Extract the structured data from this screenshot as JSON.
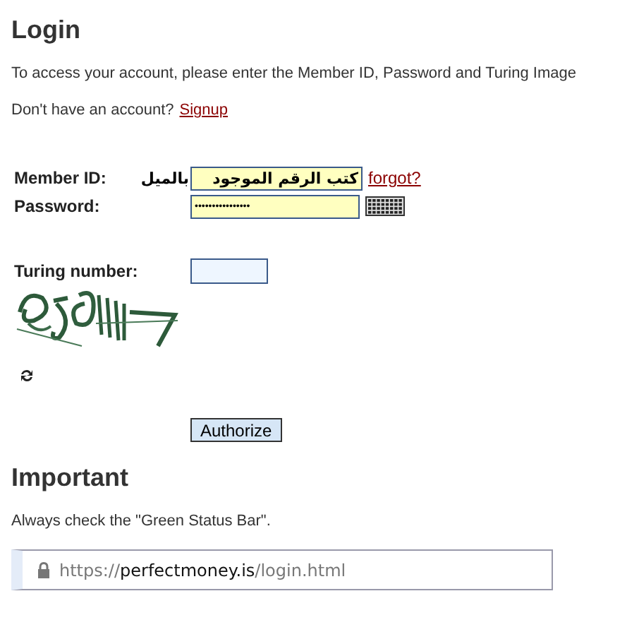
{
  "title": "Login",
  "intro": "To access your account, please enter the Member ID, Password and Turing Image",
  "signup": {
    "text": "Don't have an account?",
    "link": "Signup"
  },
  "member_id": {
    "label": "Member ID:",
    "prefix": "بالميل",
    "value": "كتب الرقم الموجود",
    "link": "forgot?"
  },
  "password": {
    "label": "Password:",
    "value": "••••••••••••••••"
  },
  "turing": {
    "label": "Turing number:"
  },
  "button": "Authorize",
  "important": {
    "title": "Important",
    "text": "Always check the \"Green Status Bar\".",
    "url": {
      "scheme": "https://",
      "domain": "perfectmoney.is",
      "path": "/login.html"
    }
  }
}
